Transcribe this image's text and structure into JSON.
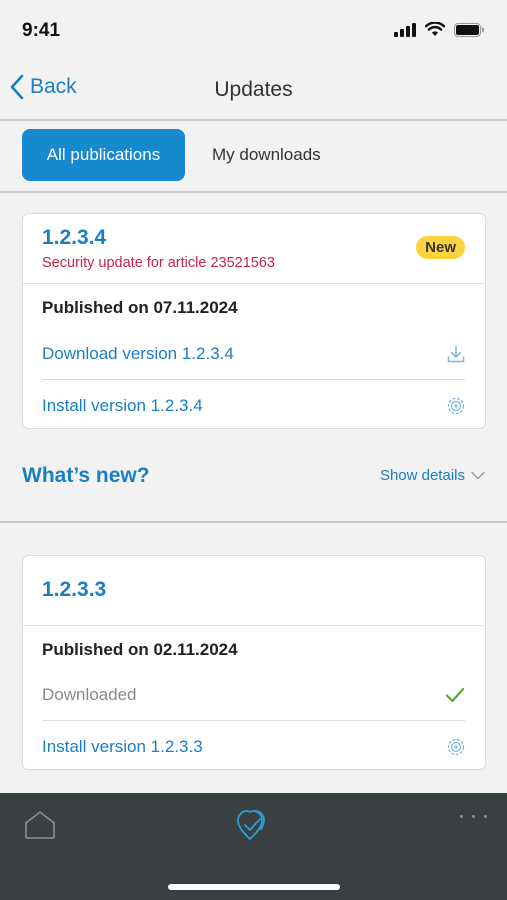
{
  "status_bar": {
    "time": "9:41"
  },
  "nav": {
    "back_label": "Back",
    "title": "Updates"
  },
  "segments": {
    "active_label": "All publications",
    "inactive_label": "My downloads"
  },
  "updates": [
    {
      "version": "1.2.3.4",
      "subtitle": "Security update for article 23521563",
      "badge": "New",
      "published": "Published on 07.11.2024",
      "download_label": "Download version 1.2.3.4",
      "install_label": "Install version 1.2.3.4"
    },
    {
      "version": "1.2.3.3",
      "published": "Published on 02.11.2024",
      "downloaded_label": "Downloaded",
      "install_label": "Install version 1.2.3.3"
    }
  ],
  "whats_new": {
    "title": "What’s new?",
    "show_details": "Show details"
  },
  "tab_bar": {
    "items": [
      "home-icon",
      "updates-shield-icon",
      "more-icon"
    ]
  },
  "colors": {
    "accent": "#1a7fc1",
    "active_segment": "#1789cf",
    "badge": "#fbd33f",
    "subtitle": "#c8234a",
    "success": "#5aa832",
    "tab_bar": "#3a3f41"
  }
}
